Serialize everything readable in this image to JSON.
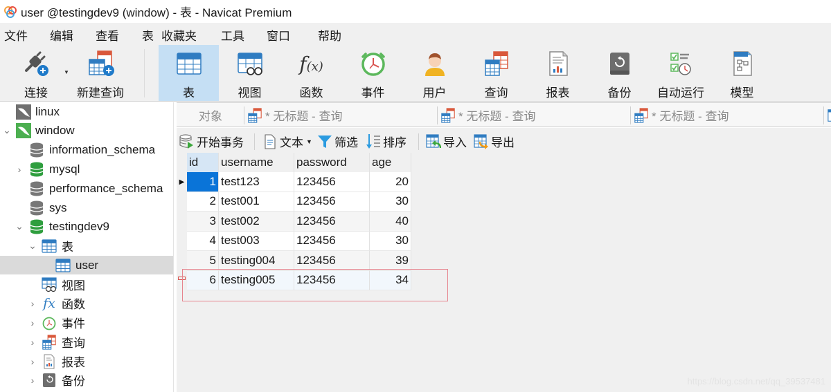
{
  "window": {
    "title": "user @testingdev9 (window) - 表 - Navicat Premium"
  },
  "menu": [
    "文件",
    "编辑",
    "查看",
    "表",
    "收藏夹",
    "工具",
    "窗口",
    "帮助"
  ],
  "toolbar": {
    "buttons": [
      {
        "label": "连接",
        "icon": "connection-plug-icon"
      },
      {
        "label": "新建查询",
        "icon": "new-query-icon"
      },
      {
        "label": "表",
        "icon": "table-icon",
        "active": true
      },
      {
        "label": "视图",
        "icon": "view-icon"
      },
      {
        "label": "函数",
        "icon": "function-icon"
      },
      {
        "label": "事件",
        "icon": "event-clock-icon"
      },
      {
        "label": "用户",
        "icon": "user-icon"
      },
      {
        "label": "查询",
        "icon": "query-icon"
      },
      {
        "label": "报表",
        "icon": "report-icon"
      },
      {
        "label": "备份",
        "icon": "backup-icon"
      },
      {
        "label": "自动运行",
        "icon": "automation-icon"
      },
      {
        "label": "模型",
        "icon": "model-icon"
      }
    ]
  },
  "sidebar": {
    "items": [
      {
        "label": "linux",
        "type": "connection",
        "state": "closed"
      },
      {
        "label": "window",
        "type": "connection",
        "state": "open"
      },
      {
        "label": "information_schema",
        "type": "database"
      },
      {
        "label": "mysql",
        "type": "database-open"
      },
      {
        "label": "performance_schema",
        "type": "database"
      },
      {
        "label": "sys",
        "type": "database"
      },
      {
        "label": "testingdev9",
        "type": "database-open"
      },
      {
        "label": "表",
        "type": "tables-folder"
      },
      {
        "label": "user",
        "type": "table",
        "selected": true
      },
      {
        "label": "视图",
        "type": "views-folder"
      },
      {
        "label": "函数",
        "type": "functions-folder"
      },
      {
        "label": "事件",
        "type": "events-folder"
      },
      {
        "label": "查询",
        "type": "queries-folder"
      },
      {
        "label": "报表",
        "type": "reports-folder"
      },
      {
        "label": "备份",
        "type": "backups-folder"
      }
    ]
  },
  "tabs": [
    {
      "label": "对象"
    },
    {
      "label": "* 无标题 - 查询"
    },
    {
      "label": "* 无标题 - 查询"
    },
    {
      "label": "* 无标题 - 查询"
    }
  ],
  "object_toolbar": {
    "begin_transaction": "开始事务",
    "text": "文本",
    "filter": "筛选",
    "sort": "排序",
    "import": "导入",
    "export": "导出"
  },
  "grid": {
    "columns": [
      "id",
      "username",
      "password",
      "age"
    ],
    "rows": [
      [
        "1",
        "test123",
        "123456",
        "20"
      ],
      [
        "2",
        "test001",
        "123456",
        "30"
      ],
      [
        "3",
        "test002",
        "123456",
        "40"
      ],
      [
        "4",
        "test003",
        "123456",
        "30"
      ],
      [
        "5",
        "testing004",
        "123456",
        "39"
      ],
      [
        "6",
        "testing005",
        "123456",
        "34"
      ]
    ],
    "current_row": 0,
    "new_row": 5
  },
  "watermark": "https://blog.csdn.net/qq_39537481",
  "colors": {
    "accent": "#0a74d8",
    "active_toolbar": "#c5dff4",
    "highlight_box": "#e6848e"
  }
}
